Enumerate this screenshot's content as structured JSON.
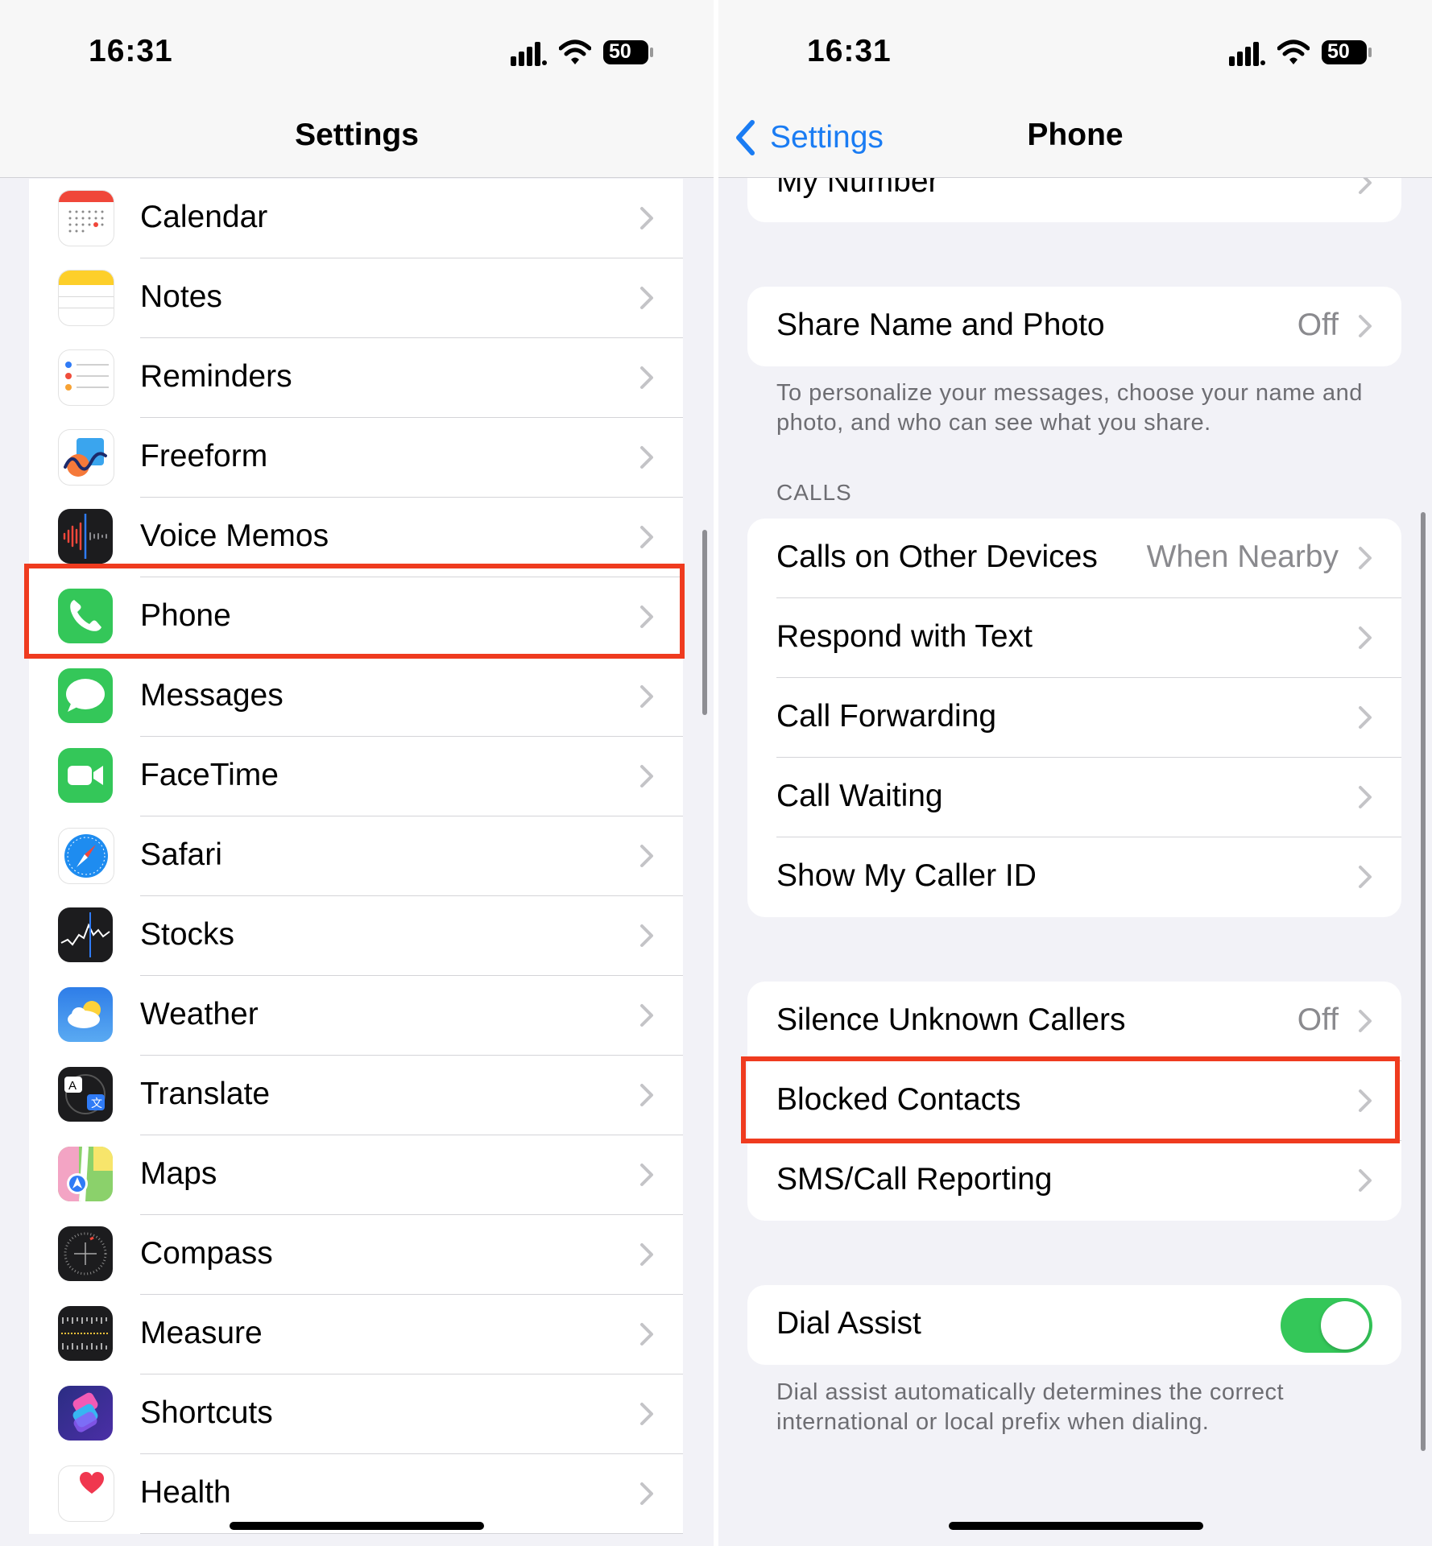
{
  "left": {
    "status": {
      "time": "16:31",
      "battery": "50"
    },
    "nav_title": "Settings",
    "items": [
      {
        "label": "Calendar",
        "icon": "calendar-icon"
      },
      {
        "label": "Notes",
        "icon": "notes-icon"
      },
      {
        "label": "Reminders",
        "icon": "reminders-icon"
      },
      {
        "label": "Freeform",
        "icon": "freeform-icon"
      },
      {
        "label": "Voice Memos",
        "icon": "voice-memos-icon"
      },
      {
        "label": "Phone",
        "icon": "phone-icon",
        "highlighted": true
      },
      {
        "label": "Messages",
        "icon": "messages-icon"
      },
      {
        "label": "FaceTime",
        "icon": "facetime-icon"
      },
      {
        "label": "Safari",
        "icon": "safari-icon"
      },
      {
        "label": "Stocks",
        "icon": "stocks-icon"
      },
      {
        "label": "Weather",
        "icon": "weather-icon"
      },
      {
        "label": "Translate",
        "icon": "translate-icon"
      },
      {
        "label": "Maps",
        "icon": "maps-icon"
      },
      {
        "label": "Compass",
        "icon": "compass-icon"
      },
      {
        "label": "Measure",
        "icon": "measure-icon"
      },
      {
        "label": "Shortcuts",
        "icon": "shortcuts-icon"
      },
      {
        "label": "Health",
        "icon": "health-icon"
      }
    ]
  },
  "right": {
    "status": {
      "time": "16:31",
      "battery": "50"
    },
    "back_label": "Settings",
    "nav_title": "Phone",
    "my_number": "My Number",
    "share_name": {
      "label": "Share Name and Photo",
      "value": "Off"
    },
    "share_footnote": "To personalize your messages, choose your name and photo, and who can see what you share.",
    "calls_header": "CALLS",
    "calls": [
      {
        "label": "Calls on Other Devices",
        "value": "When Nearby"
      },
      {
        "label": "Respond with Text",
        "value": ""
      },
      {
        "label": "Call Forwarding",
        "value": ""
      },
      {
        "label": "Call Waiting",
        "value": ""
      },
      {
        "label": "Show My Caller ID",
        "value": ""
      }
    ],
    "blocking": [
      {
        "label": "Silence Unknown Callers",
        "value": "Off"
      },
      {
        "label": "Blocked Contacts",
        "value": "",
        "highlighted": true
      },
      {
        "label": "SMS/Call Reporting",
        "value": ""
      }
    ],
    "dial_assist": {
      "label": "Dial Assist",
      "enabled": true
    },
    "dial_footnote": "Dial assist automatically determines the correct international or local prefix when dialing."
  },
  "colors": {
    "accent": "#1a7cf3",
    "highlight": "#ef3b1f",
    "toggle_on": "#34c759"
  }
}
